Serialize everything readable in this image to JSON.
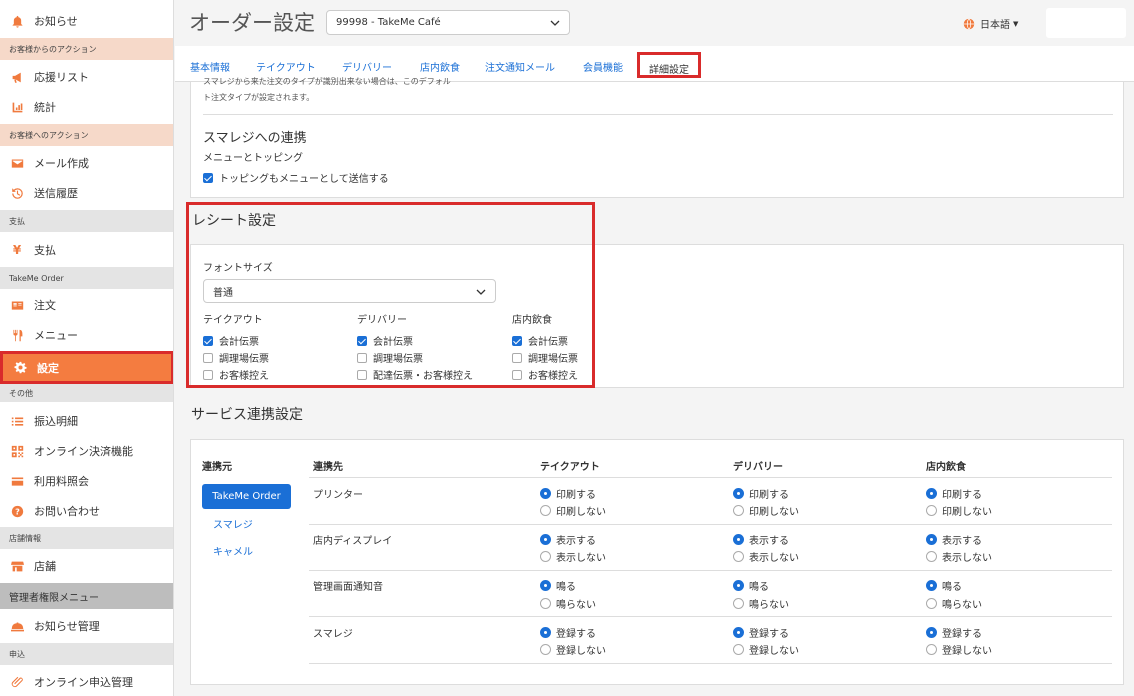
{
  "sidebar": {
    "items": [
      {
        "label": "お知らせ",
        "icon": "bell-icon"
      },
      {
        "label": "応援リスト",
        "icon": "megaphone-icon"
      },
      {
        "label": "統計",
        "icon": "chart-icon"
      },
      {
        "label": "メール作成",
        "icon": "envelope-icon"
      },
      {
        "label": "送信履歴",
        "icon": "history-icon"
      },
      {
        "label": "支払",
        "icon": "yen-icon"
      },
      {
        "label": "注文",
        "icon": "receipt-icon"
      },
      {
        "label": "メニュー",
        "icon": "cutlery-icon"
      },
      {
        "label": "設定",
        "icon": "gear-icon"
      },
      {
        "label": "振込明細",
        "icon": "list-icon"
      },
      {
        "label": "オンライン決済機能",
        "icon": "qr-icon"
      },
      {
        "label": "利用料照会",
        "icon": "card-icon"
      },
      {
        "label": "お問い合わせ",
        "icon": "question-icon"
      },
      {
        "label": "店舗",
        "icon": "store-icon"
      },
      {
        "label": "お知らせ管理",
        "icon": "bell-service-icon"
      },
      {
        "label": "オンライン申込管理",
        "icon": "paperclip-icon"
      }
    ],
    "sections": [
      "お客様からのアクション",
      "お客様へのアクション",
      "支払",
      "TakeMe Order",
      "その他",
      "店舗情報",
      "管理者権限メニュー",
      "申込"
    ]
  },
  "header": {
    "title": "オーダー設定",
    "store_select": "99998 - TakeMe Café",
    "language": "日本語"
  },
  "tabs": [
    "基本情報",
    "テイクアウト",
    "デリバリー",
    "店内飲食",
    "注文通知メール",
    "会員機能",
    "詳細設定"
  ],
  "top_card": {
    "note_line1": "スマレジから来た注文のタイプが識別出来ない場合は、このデフォル",
    "note_line2": "ト注文タイプが設定されます。",
    "smaregi_heading": "スマレジへの連携",
    "menu_topping_label": "メニューとトッピング",
    "topping_checkbox": "トッピングもメニューとして送信する"
  },
  "receipt": {
    "heading": "レシート設定",
    "font_size_label": "フォントサイズ",
    "font_size_value": "普通",
    "columns": [
      {
        "title": "テイクアウト",
        "options": [
          {
            "label": "会計伝票",
            "checked": true
          },
          {
            "label": "調理場伝票",
            "checked": false
          },
          {
            "label": "お客様控え",
            "checked": false
          }
        ]
      },
      {
        "title": "デリバリー",
        "options": [
          {
            "label": "会計伝票",
            "checked": true
          },
          {
            "label": "調理場伝票",
            "checked": false
          },
          {
            "label": "配達伝票・お客様控え",
            "checked": false
          }
        ]
      },
      {
        "title": "店内飲食",
        "options": [
          {
            "label": "会計伝票",
            "checked": true
          },
          {
            "label": "調理場伝票",
            "checked": false
          },
          {
            "label": "お客様控え",
            "checked": false
          }
        ]
      }
    ]
  },
  "service": {
    "heading": "サービス連携設定",
    "source_header": "連携元",
    "sources": [
      "TakeMe Order",
      "スマレジ",
      "キャメル"
    ],
    "headers": [
      "連携先",
      "テイクアウト",
      "デリバリー",
      "店内飲食"
    ],
    "rows": [
      {
        "label": "プリンター",
        "on": "印刷する",
        "off": "印刷しない"
      },
      {
        "label": "店内ディスプレイ",
        "on": "表示する",
        "off": "表示しない"
      },
      {
        "label": "管理画面通知音",
        "on": "鳴る",
        "off": "鳴らない"
      },
      {
        "label": "スマレジ",
        "on": "登録する",
        "off": "登録しない"
      }
    ]
  },
  "colors": {
    "accent": "#f47c40",
    "link": "#1a6fd6",
    "highlight": "#d92b2b"
  }
}
